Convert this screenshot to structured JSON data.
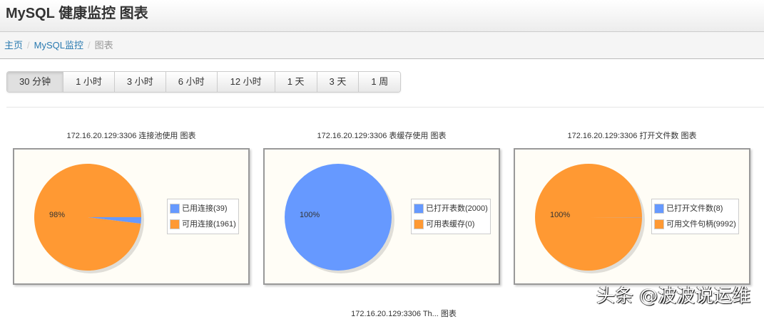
{
  "header": {
    "title": "MySQL 健康监控 图表"
  },
  "breadcrumb": {
    "home": "主页",
    "section": "MySQL监控",
    "current": "图表",
    "separator": "/"
  },
  "time_ranges": {
    "selected": "30 分钟",
    "items": [
      "30 分钟",
      "1 小时",
      "3 小时",
      "6 小时",
      "12 小时",
      "1 天",
      "3 天",
      "1 周"
    ]
  },
  "colors": {
    "blue": "#6699ff",
    "orange": "#ff9933"
  },
  "chart_data": [
    {
      "type": "pie",
      "title": "172.16.20.129:3306 连接池使用 图表",
      "slices": [
        {
          "label": "已用连接(39)",
          "value": 39,
          "color": "#6699ff"
        },
        {
          "label": "可用连接(1961)",
          "value": 1961,
          "color": "#ff9933"
        }
      ],
      "data_label": "98%",
      "legend": "right"
    },
    {
      "type": "pie",
      "title": "172.16.20.129:3306 表缓存使用 图表",
      "slices": [
        {
          "label": "已打开表数(2000)",
          "value": 2000,
          "color": "#6699ff"
        },
        {
          "label": "可用表缓存(0)",
          "value": 0,
          "color": "#ff9933"
        }
      ],
      "data_label": "100%",
      "legend": "right"
    },
    {
      "type": "pie",
      "title": "172.16.20.129:3306 打开文件数 图表",
      "slices": [
        {
          "label": "已打开文件数(8)",
          "value": 8,
          "color": "#6699ff"
        },
        {
          "label": "可用文件句柄(9992)",
          "value": 9992,
          "color": "#ff9933"
        }
      ],
      "data_label": "100%",
      "legend": "right"
    }
  ],
  "bottom_chart_title": "172.16.20.129:3306 Th... 图表",
  "watermark": "头条 @波波说运维"
}
